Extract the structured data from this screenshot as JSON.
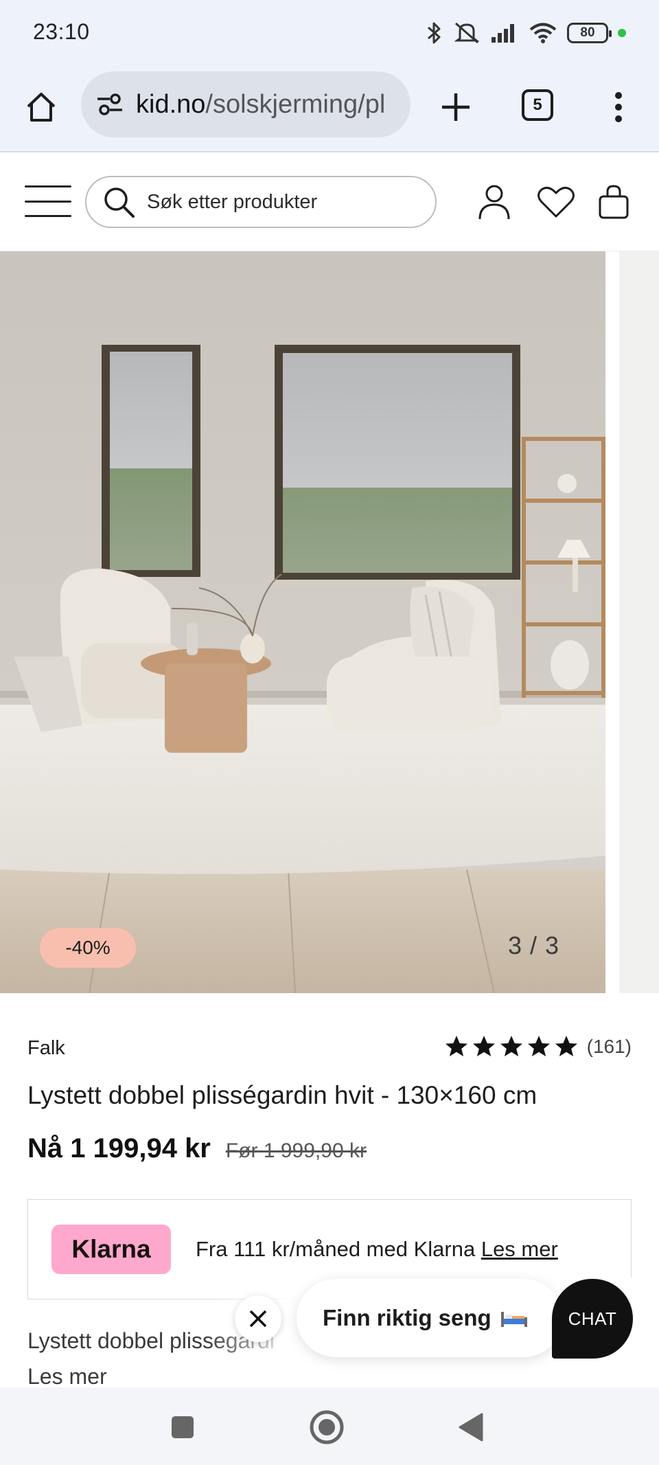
{
  "status_bar": {
    "time": "23:10",
    "battery": "80",
    "icons": [
      "bluetooth-icon",
      "mute-icon",
      "signal-icon",
      "wifi-icon",
      "battery-icon"
    ]
  },
  "browser": {
    "url_domain": "kid.no",
    "url_path": "/solskjerming/pl",
    "tab_count": "5"
  },
  "header": {
    "search_placeholder": "Søk etter produkter"
  },
  "gallery": {
    "discount": "-40%",
    "counter": "3 / 3"
  },
  "product": {
    "brand": "Falk",
    "rating_value": 5,
    "rating_count": "(161)",
    "title": "Lystett dobbel plisségardin hvit - 130×160 cm",
    "price_now": "Nå 1 199,94 kr",
    "price_old": "Før 1 999,90 kr"
  },
  "klarna": {
    "logo": "Klarna",
    "text": "Fra 111 kr/måned med Klarna ",
    "link": "Les mer"
  },
  "description": {
    "snippet": "Lystett dobbel plissegardi",
    "read_more": "Les mer"
  },
  "promo": {
    "text": "Finn riktig seng",
    "chat_label": "CHAT"
  },
  "colors": {
    "discount_badge": "#f8bfae",
    "klarna_pink": "#ffa8cd",
    "chat_black": "#111111"
  }
}
